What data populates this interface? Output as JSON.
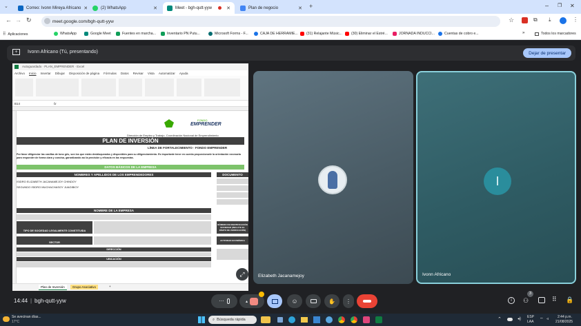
{
  "browser": {
    "tabs": [
      {
        "label": "Correo: Ivonn Mireya Africano",
        "color": "#0a66c2"
      },
      {
        "label": "(2) WhatsApp",
        "color": "#25d366"
      },
      {
        "label": "Meet - bgh-qutt-yyw",
        "color": "#00897b"
      },
      {
        "label": "Plan de negocio",
        "color": "#4285f4"
      }
    ],
    "url": "meet.google.com/bgh-qutt-yyw",
    "bookmarks": [
      "Aplicaciones",
      "WhatsApp",
      "Google Meet",
      "Fuentes en marcha...",
      "Inventario PN Putu...",
      "Microsoft Forms - F...",
      "CAJA DE HERRAMIE...",
      "(31) Relajante Músic...",
      "(30) Eliminar el Estré...",
      "JORNADA INDUCCI...",
      "Cuentas de cobro e..."
    ],
    "all_bookmarks": "Todos los marcadores"
  },
  "meet": {
    "presenter": "Ivonn Africano (Tú, presentando)",
    "stop_presenting": "Dejar de presentar",
    "time": "14:44",
    "meeting_code": "bgh-qutt-yyw",
    "participant_count": "3",
    "participants": [
      {
        "name": "Elizabeth Jacanamejoy"
      },
      {
        "name": "Ivonn Africano",
        "initial": "I"
      }
    ]
  },
  "sheet": {
    "title_text": "Autoguardado · PLAN_EMPRENDER · Excel",
    "menu": [
      "Archivo",
      "Inicio",
      "Insertar",
      "Dibujar",
      "Disposición de página",
      "Fórmulas",
      "Datos",
      "Revisar",
      "Vista",
      "Automatizar",
      "Ayuda"
    ],
    "cell_ref": "B14",
    "col_letters": [
      "A",
      "B",
      "C",
      "D",
      "E",
      "F",
      "G",
      "H",
      "I",
      "J",
      "K",
      "L",
      "M",
      "N",
      "O",
      "P",
      "Q",
      "R",
      "S",
      "T",
      "U"
    ],
    "logo_text": "EMPRENDER",
    "logo_sub": "FONDO",
    "direccion": "Dirección de Empleo y Trabajo, Coordinación Nacional de Emprendimiento",
    "plan_title": "PLAN DE INVERSIÓN",
    "plan_sub": "LÍNEA DE FORTALECIMIENTO - FONDO EMPRENDER",
    "instructions": "Por favor diligenciar las casillas de tono gris, son los que están desbloqueados y disponibles para su diligenciamiento. Es importante tener en cuenta proporcionarle la orientación necesaria para responder de forma clara y concisa, garantizando así la precisión y eficacia en las respuestas.",
    "basic_data": "DATOS BÁSICOS DE LA EMPRESA",
    "col_names": "NOMBRES Y APELLIDOS DE LOS EMPRENDEDORES",
    "col_doc": "DOCUMENTO",
    "entrepreneurs": [
      "ISIDRO ELIZABETH JACANAMEJOY CHINDOY",
      "SEGUNDO ISIDRO MUCHACHASOY JUAGIBIOY"
    ],
    "company_name": "NOMBRE DE LA EMPRESA",
    "society_type": "TIPO DE SOCIEDAD LEGALMENTE CONSTITUIDA",
    "nit_label": "NÚMERO DE IDENTIFICACIÓN SOCIEDAD (INCLUYE EL DÍGITO DE VERIFICACIÓN)",
    "sector": "SECTOR",
    "activity": "ACTIVIDAD ECONÓMICA",
    "address": "DIRECCIÓN",
    "location": "UBICACIÓN",
    "sheet_tabs": [
      "Plan de Inversión",
      "Grupo Asociativo"
    ]
  },
  "taskbar": {
    "weather": "Se avecinan días...",
    "temp": "17°C",
    "search": "Búsqueda rápida",
    "lang": "ESP",
    "lang2": "LAA",
    "clock": "2:44 p.m.",
    "date": "21/08/2025"
  }
}
